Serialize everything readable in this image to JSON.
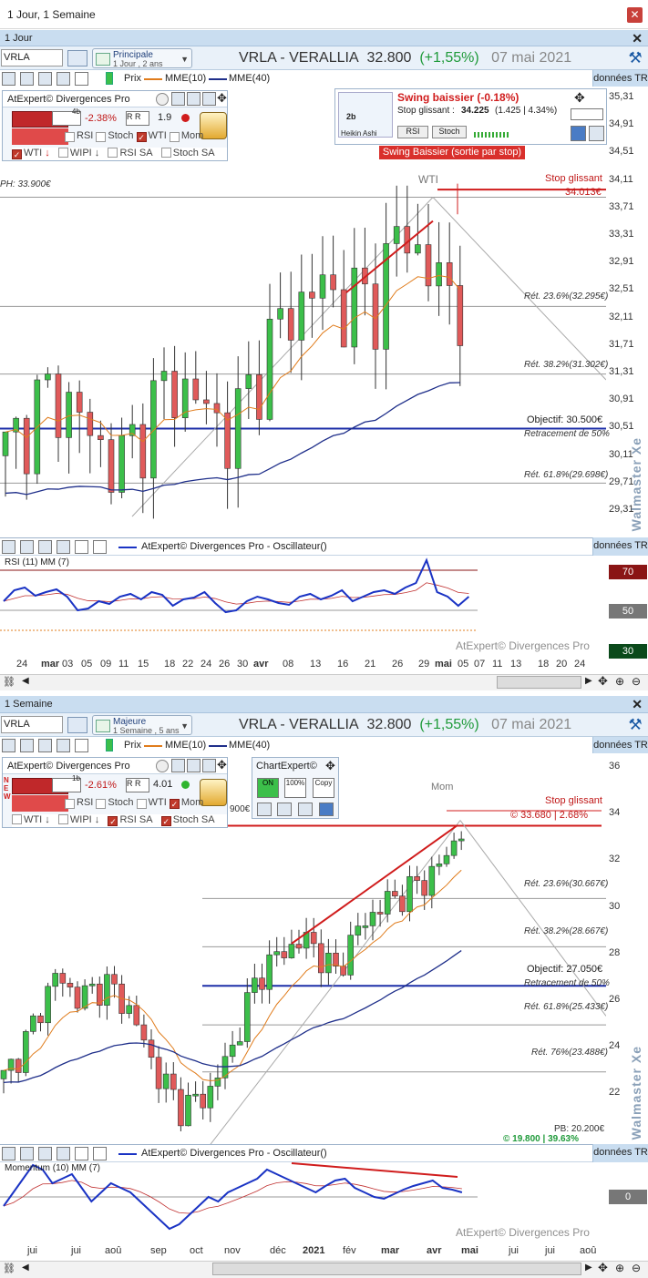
{
  "window": {
    "title": "1 Jour, 1 Semaine"
  },
  "symbol": {
    "ticker": "VRLA",
    "name": "VRLA - VERALLIA",
    "price": "32.800",
    "change": "(+1,55%)",
    "date": "07 mai 2021"
  },
  "legend": {
    "price": "Prix",
    "mme10": "MME(10)",
    "mme40": "MME(40)",
    "donnees": "données TR"
  },
  "daily": {
    "panel_title": "1 Jour",
    "selector_l1": "Principale",
    "selector_l2": "1 Jour , 2 ans",
    "indicator": {
      "title": "AtExpert© Divergences Pro",
      "pct": "-2.38%",
      "rr": "1.9",
      "period": "4b",
      "checks": [
        "RSI",
        "Stoch",
        "WTI",
        "Mom"
      ],
      "checks_on": [
        false,
        false,
        true,
        false
      ],
      "checks2": [
        "WTI",
        "WIPI",
        "RSI SA",
        "Stoch SA"
      ],
      "checks2_on": [
        true,
        false,
        false,
        false
      ]
    },
    "swing": {
      "title": "Swing baissier (-0.18%)",
      "stop_label": "Stop glissant :",
      "stop_value": "34.225",
      "stop_detail": "(1.425 | 4.34%)",
      "rsi": "RSI",
      "stoch": "Stoch",
      "period": "2b",
      "heikin": "Heikin Ashi",
      "banner": "Swing Baissier (sortie par stop)"
    },
    "ph": "PH: 33.900€",
    "wti": "WTI",
    "stop_label": "Stop glissant",
    "stop_value": "34.013€",
    "levels": [
      {
        "t": "Rét. 23.6%(32.295€)"
      },
      {
        "t": "Rét. 38.2%(31.302€)"
      },
      {
        "t": "Objectif: 30.500€"
      },
      {
        "t": "Retracement de 50%"
      },
      {
        "t": "Rét. 61.8%(29.698€)"
      }
    ],
    "price_axis": [
      "35,31",
      "34,91",
      "34,51",
      "34,11",
      "33,71",
      "33,31",
      "32,91",
      "32,51",
      "32,11",
      "31,71",
      "31,31",
      "30,91",
      "30,51",
      "30,11",
      "29,71",
      "29,31"
    ],
    "osc_title": "AtExpert© Divergences Pro - Oscillateur()",
    "osc_label": "RSI (11) MM (7)",
    "osc_levels": [
      "70",
      "50",
      "30"
    ],
    "x_labels": [
      "24",
      "mar",
      "03",
      "05",
      "09",
      "11",
      "15",
      "18",
      "22",
      "24",
      "26",
      "30",
      "avr",
      "08",
      "13",
      "16",
      "21",
      "26",
      "29",
      "mai",
      "05",
      "07",
      "11",
      "13",
      "18",
      "20",
      "24"
    ],
    "watermark": "Walmaster Xe",
    "credit": "AtExpert© Divergences Pro"
  },
  "weekly": {
    "panel_title": "1 Semaine",
    "selector_l1": "Majeure",
    "selector_l2": "1 Semaine , 5 ans",
    "indicator": {
      "title": "AtExpert© Divergences Pro",
      "pct": "-2.61%",
      "rr": "4.01",
      "period": "1b",
      "new": "NEW",
      "checks": [
        "RSI",
        "Stoch",
        "WTI",
        "Mom"
      ],
      "checks_on": [
        false,
        false,
        false,
        true
      ],
      "checks2": [
        "WTI",
        "WIPI",
        "RSI SA",
        "Stoch SA"
      ],
      "checks2_on": [
        false,
        false,
        true,
        true
      ]
    },
    "chartexpert": {
      "title": "ChartExpert©",
      "on": "ON",
      "pct": "100%",
      "copy": "Copy"
    },
    "ph_partial": "900€",
    "mom": "Mom",
    "stop_label": "Stop glissant",
    "stop_value": "33.680 | 2.68%",
    "levels": [
      {
        "t": "Rét. 23.6%(30.667€)"
      },
      {
        "t": "Rét. 38.2%(28.667€)"
      },
      {
        "t": "Objectif: 27.050€"
      },
      {
        "t": "Retracement de 50%"
      },
      {
        "t": "Rét. 61.8%(25.433€)"
      },
      {
        "t": "Rét. 76%(23.488€)"
      }
    ],
    "pb": "PB: 20.200€",
    "pb2": "© 19.800 | 39.63%",
    "price_axis": [
      "36",
      "34",
      "32",
      "30",
      "28",
      "26",
      "24",
      "22"
    ],
    "osc_title": "AtExpert© Divergences Pro - Oscillateur()",
    "osc_label": "Momentum (10) MM (7)",
    "osc_levels": [
      "0"
    ],
    "x_labels": [
      "jui",
      "jui",
      "aoû",
      "sep",
      "oct",
      "nov",
      "déc",
      "2021",
      "fév",
      "mar",
      "avr",
      "mai",
      "jui",
      "jui",
      "aoû"
    ],
    "watermark": "Walmaster Xe",
    "credit": "AtExpert© Divergences Pro"
  },
  "colors": {
    "up": "#3cbf4a",
    "down": "#e05a5a",
    "mme10": "#e07c1c",
    "mme40": "#1f2f8a",
    "rsi": "#1a33c4",
    "red": "#d01c1c",
    "blueline": "#1d2fa8"
  }
}
